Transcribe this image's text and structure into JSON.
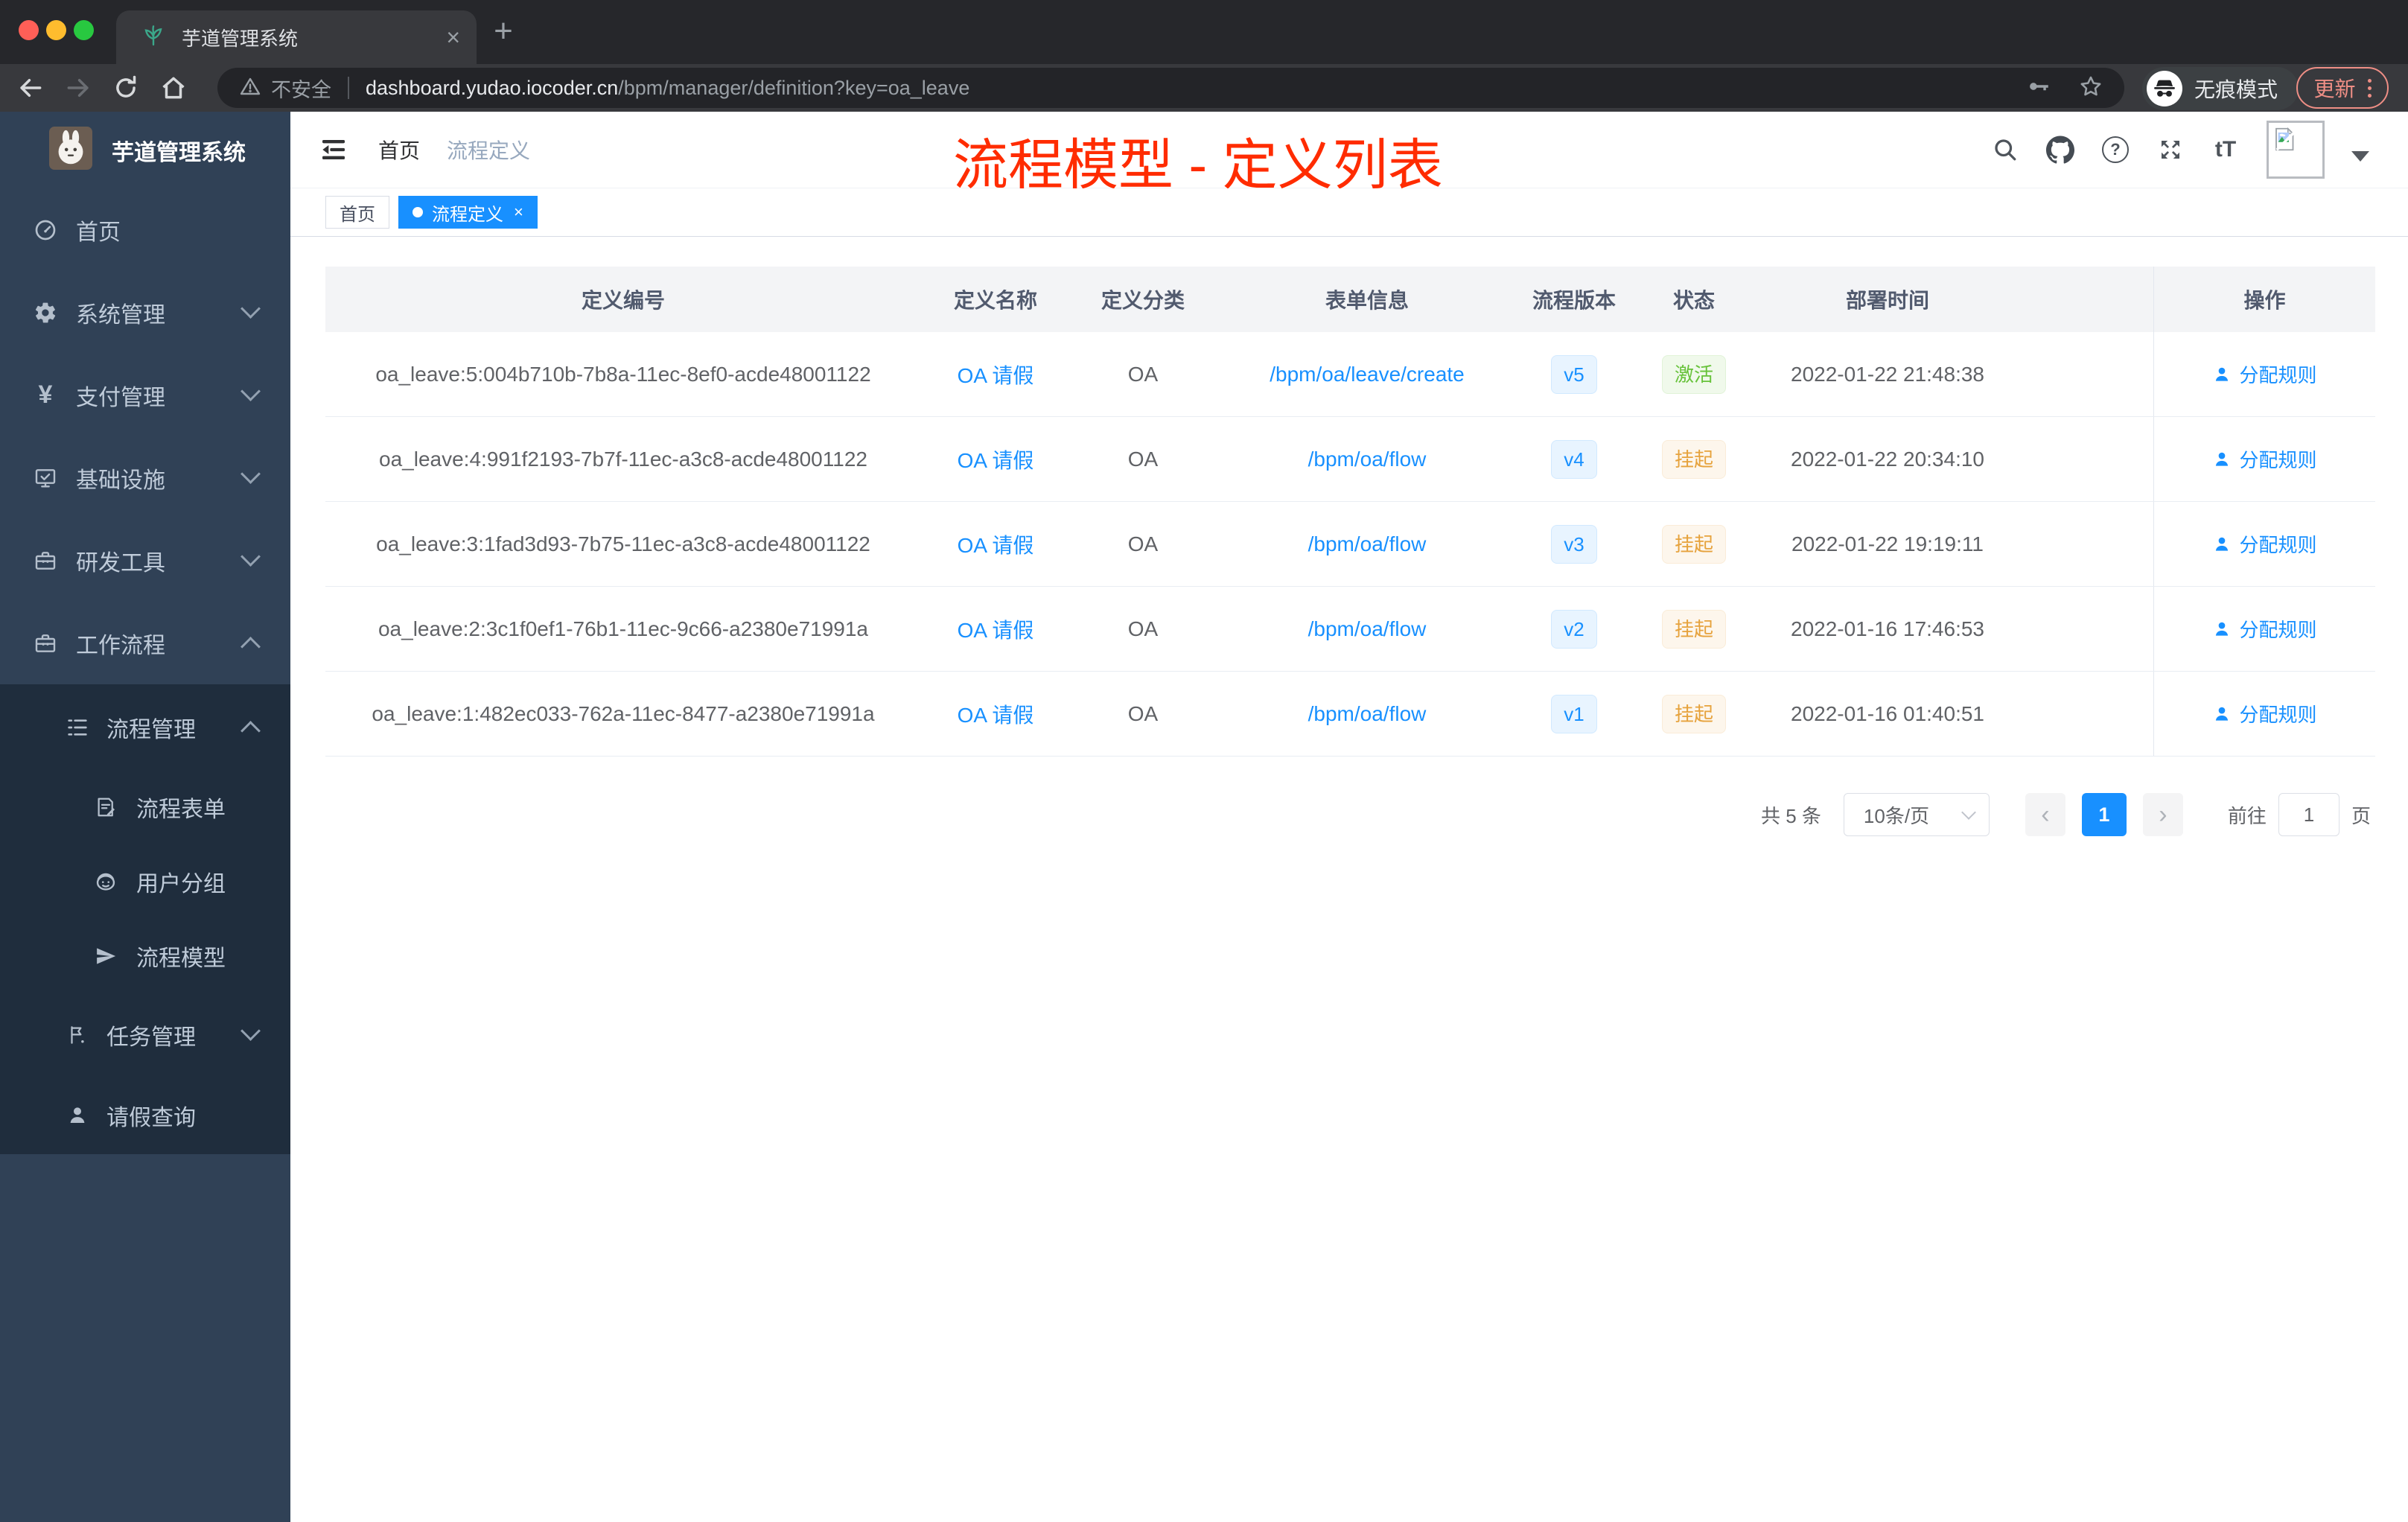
{
  "theme": {
    "primary": "#1890ff",
    "success_green": "#67c23a",
    "warning_orange": "#e6a23c",
    "annotation_red": "#ff2c00",
    "sidebar_bg": "#304156",
    "submenu_bg": "#1f2d3d"
  },
  "browser": {
    "tab_title": "芋道管理系统",
    "security_label": "不安全",
    "url_domain": "dashboard.yudao.iocoder.cn",
    "url_path": "/bpm/manager/definition?key=oa_leave",
    "incognito_label": "无痕模式",
    "update_label": "更新"
  },
  "icons": {
    "new_tab": "+",
    "tab_close": "×",
    "tag_close": "×",
    "help_glyph": "?",
    "text_size_glyph": "tT",
    "yen_glyph": "¥",
    "prev_glyph": "‹",
    "next_glyph": "›"
  },
  "sidebar": {
    "logo_title": "芋道管理系统",
    "items": [
      {
        "label": "首页",
        "icon": "dashboard-icon"
      },
      {
        "label": "系统管理",
        "icon": "gear-icon"
      },
      {
        "label": "支付管理",
        "icon": "yen-icon"
      },
      {
        "label": "基础设施",
        "icon": "monitor-icon"
      },
      {
        "label": "研发工具",
        "icon": "toolbox-icon"
      },
      {
        "label": "工作流程",
        "icon": "briefcase-icon"
      },
      {
        "label": "流程管理",
        "icon": "tree-list-icon"
      },
      {
        "label": "流程表单",
        "icon": "form-icon"
      },
      {
        "label": "用户分组",
        "icon": "user-group-icon"
      },
      {
        "label": "流程模型",
        "icon": "paper-plane-icon"
      },
      {
        "label": "任务管理",
        "icon": "flag-icon"
      },
      {
        "label": "请假查询",
        "icon": "person-icon"
      }
    ]
  },
  "navbar": {
    "breadcrumb_home": "首页",
    "breadcrumb_sep": "/",
    "breadcrumb_current": "流程定义"
  },
  "annotation": "流程模型 - 定义列表",
  "tags": {
    "home": "首页",
    "active": "流程定义"
  },
  "table": {
    "headers": [
      "定义编号",
      "定义名称",
      "定义分类",
      "表单信息",
      "流程版本",
      "状态",
      "部署时间",
      "操作"
    ],
    "rows": [
      {
        "id": "oa_leave:5:004b710b-7b8a-11ec-8ef0-acde48001122",
        "name": "OA 请假",
        "category": "OA",
        "form": "/bpm/oa/leave/create",
        "version": "v5",
        "status": "激活",
        "deploy_time": "2022-01-22 21:48:38",
        "action": "分配规则"
      },
      {
        "id": "oa_leave:4:991f2193-7b7f-11ec-a3c8-acde48001122",
        "name": "OA 请假",
        "category": "OA",
        "form": "/bpm/oa/flow",
        "version": "v4",
        "status": "挂起",
        "deploy_time": "2022-01-22 20:34:10",
        "action": "分配规则"
      },
      {
        "id": "oa_leave:3:1fad3d93-7b75-11ec-a3c8-acde48001122",
        "name": "OA 请假",
        "category": "OA",
        "form": "/bpm/oa/flow",
        "version": "v3",
        "status": "挂起",
        "deploy_time": "2022-01-22 19:19:11",
        "action": "分配规则"
      },
      {
        "id": "oa_leave:2:3c1f0ef1-76b1-11ec-9c66-a2380e71991a",
        "name": "OA 请假",
        "category": "OA",
        "form": "/bpm/oa/flow",
        "version": "v2",
        "status": "挂起",
        "deploy_time": "2022-01-16 17:46:53",
        "action": "分配规则"
      },
      {
        "id": "oa_leave:1:482ec033-762a-11ec-8477-a2380e71991a",
        "name": "OA 请假",
        "category": "OA",
        "form": "/bpm/oa/flow",
        "version": "v1",
        "status": "挂起",
        "deploy_time": "2022-01-16 01:40:51",
        "action": "分配规则"
      }
    ]
  },
  "pagination": {
    "total": "共 5 条",
    "page_size": "10条/页",
    "current": "1",
    "goto_label": "前往",
    "goto_value": "1",
    "unit": "页"
  }
}
